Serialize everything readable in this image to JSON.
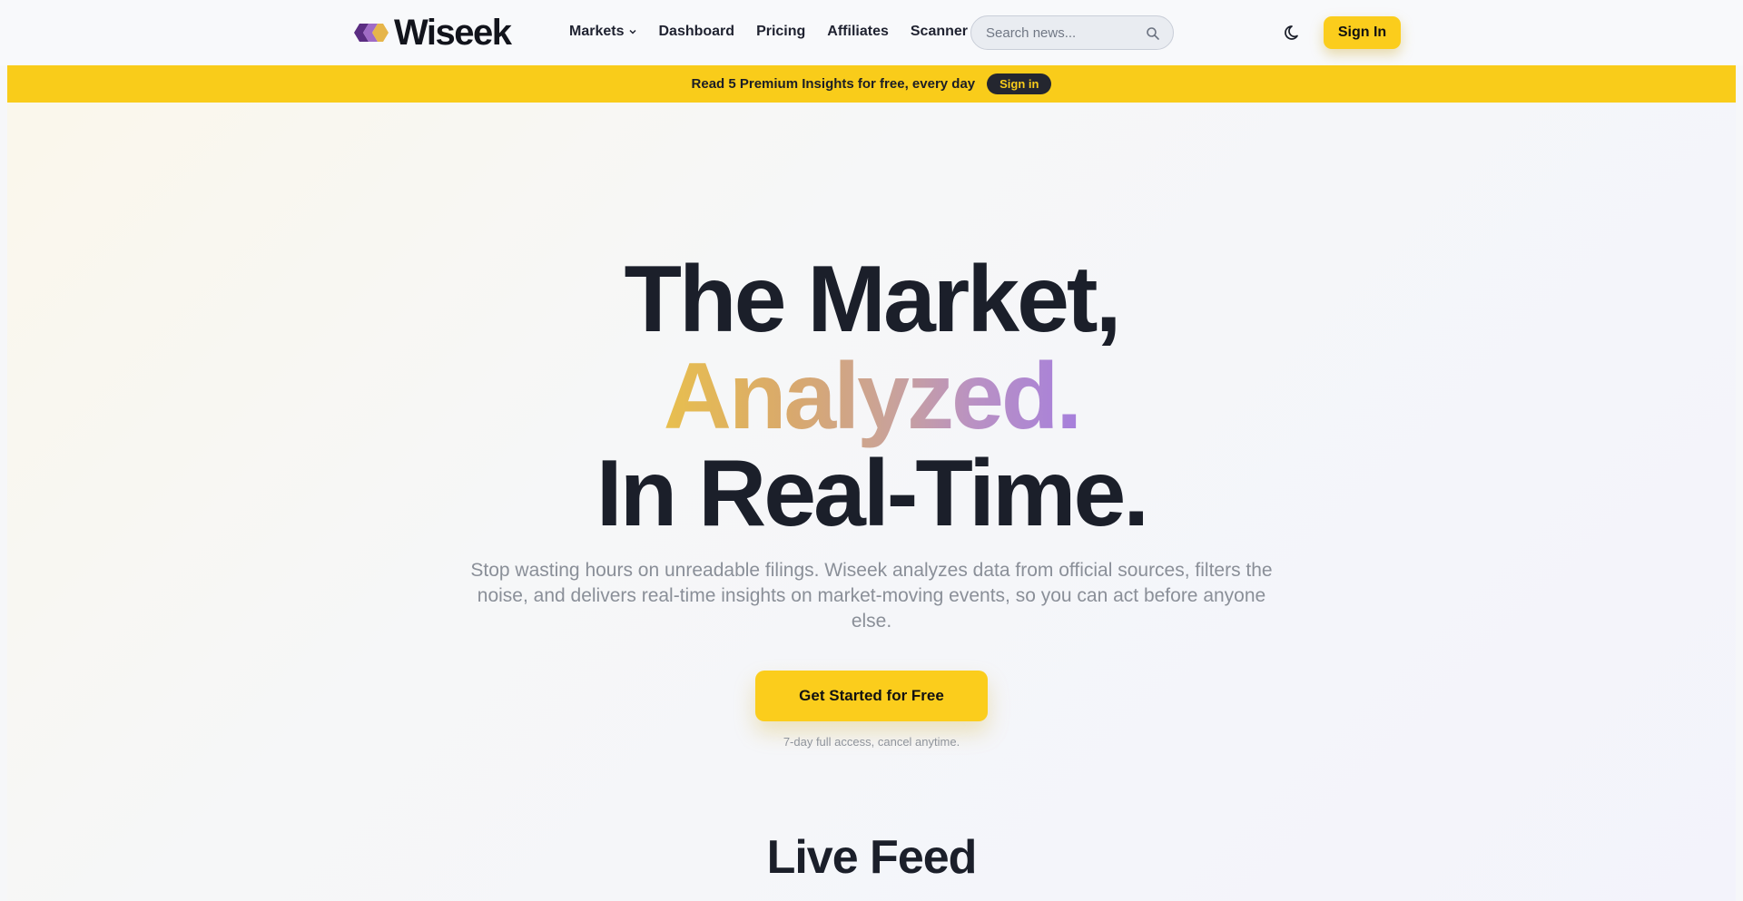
{
  "brand": {
    "name": "Wiseek"
  },
  "nav": {
    "items": [
      {
        "label": "Markets"
      },
      {
        "label": "Dashboard"
      },
      {
        "label": "Pricing"
      },
      {
        "label": "Affiliates"
      },
      {
        "label": "Scanner"
      }
    ]
  },
  "search": {
    "placeholder": "Search news..."
  },
  "header": {
    "signin_label": "Sign In"
  },
  "banner": {
    "text": "Read 5 Premium Insights for free, every day",
    "button_label": "Sign in"
  },
  "hero": {
    "line1": "The Market,",
    "line2": "Analyzed.",
    "line3": "In Real-Time.",
    "subtitle": "Stop wasting hours on unreadable filings. Wiseek analyzes data from official sources, filters the noise, and delivers real-time insights on market-moving events, so you can act before anyone else.",
    "cta_label": "Get Started for Free",
    "cta_note": "7-day full access, cancel anytime."
  },
  "sections": {
    "live_feed_title": "Live Feed"
  },
  "colors": {
    "accent": "#fbcd1c",
    "dark": "#1b1f2a",
    "gradient_start": "#e8bf4e",
    "gradient_end": "#a67fdc"
  }
}
